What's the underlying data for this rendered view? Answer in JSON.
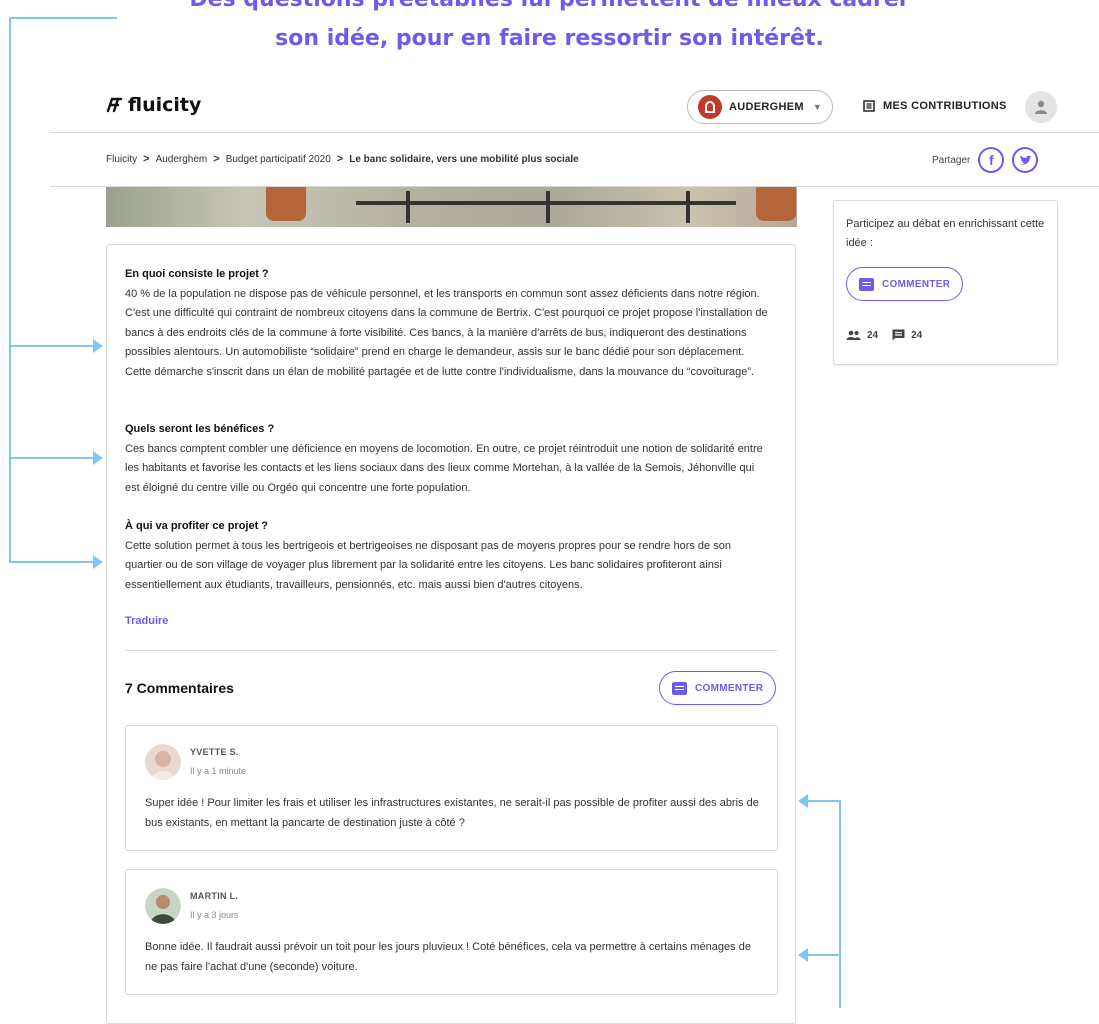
{
  "annotation": {
    "line1": "Des questions préétablies lui permettent de mieux cadrer",
    "line2": "son idée, pour en faire ressortir son intérêt."
  },
  "colors": {
    "accent": "#6c5ce7",
    "annotation_arrow": "#7ec8f0"
  },
  "header": {
    "logo_text": "fluicity",
    "city_select": {
      "label": "AUDERGHEM",
      "icon": "auderghem-crest-icon"
    },
    "contributions_label": "MES CONTRIBUTIONS",
    "contributions_icon": "document-list-icon",
    "avatar_icon": "user-icon"
  },
  "breadcrumb": {
    "items": [
      "Fluicity",
      "Auderghem",
      "Budget participatif 2020"
    ],
    "current": "Le banc solidaire, vers une mobilité plus sociale",
    "separator": ">"
  },
  "share": {
    "label": "Partager",
    "facebook": "f",
    "twitter": "twitter-icon"
  },
  "article": {
    "sections": [
      {
        "heading": "En quoi consiste le projet ?",
        "text": "40 % de la population ne dispose pas de véhicule personnel, et les transports en commun sont assez déficients dans notre région. C'est une difficulté qui contraint de nombreux citoyens dans la commune de Bertrix. C'est pourquoi ce projet propose l'installation de bancs à des endroits clés de la commune à forte visibilité. Ces bancs, à la manière d'arrêts de bus, indiqueront des destinations possibles alentours. Un automobiliste “solidaire” prend en charge le demandeur, assis sur le banc dédié pour son déplacement. Cette démarche s'inscrit dans un élan de mobilité partagée et de lutte contre l'individualisme, dans la mouvance du “covoiturage”."
      },
      {
        "heading": "Quels seront les bénéfices ?",
        "text": "Ces bancs comptent combler une déficience en moyens de locomotion. En outre, ce projet réintroduit une notion de solidarité entre les habitants et favorise les contacts et les liens sociaux dans des lieux comme Mortehan, à la vallée de la Semois, Jéhonville qui est éloigné du centre ville ou Orgéo qui concentre une forte population."
      },
      {
        "heading": "À qui va profiter ce projet ?",
        "text": "Cette solution permet à tous les bertrigeois et bertrigeoises ne disposant pas de moyens propres pour se rendre hors de son quartier ou de son village de voyager plus librement par la solidarité entre les citoyens. Les banc solidaires profiteront ainsi essentiellement aux étudiants, travailleurs, pensionnés, etc. mais aussi bien d'autres citoyens."
      }
    ],
    "translate_label": "Traduire"
  },
  "comments": {
    "title": "7 Commentaires",
    "button_label": "COMMENTER",
    "items": [
      {
        "author": "YVETTE S.",
        "time": "Il y a 1 minute",
        "text": "Super idée ! Pour limiter les frais et utiliser les infrastructures existantes, ne serait-il pas possible de profiter aussi des abris de bus existants, en mettant la pancarte de destination juste à côté ?"
      },
      {
        "author": "MARTIN L.",
        "time": "Il y a 3 jours",
        "text": "Bonne idée. Il faudrait aussi prévoir un toit pour les jours pluvieux ! Coté bénéfices, cela va permettre à certains ménages de ne pas faire l'achat d'une (seconde) voiture."
      }
    ]
  },
  "sidebar": {
    "intro": "Participez au débat en enrichissant cette idée :",
    "button_label": "COMMENTER",
    "participants": "24",
    "comments_count": "24"
  }
}
